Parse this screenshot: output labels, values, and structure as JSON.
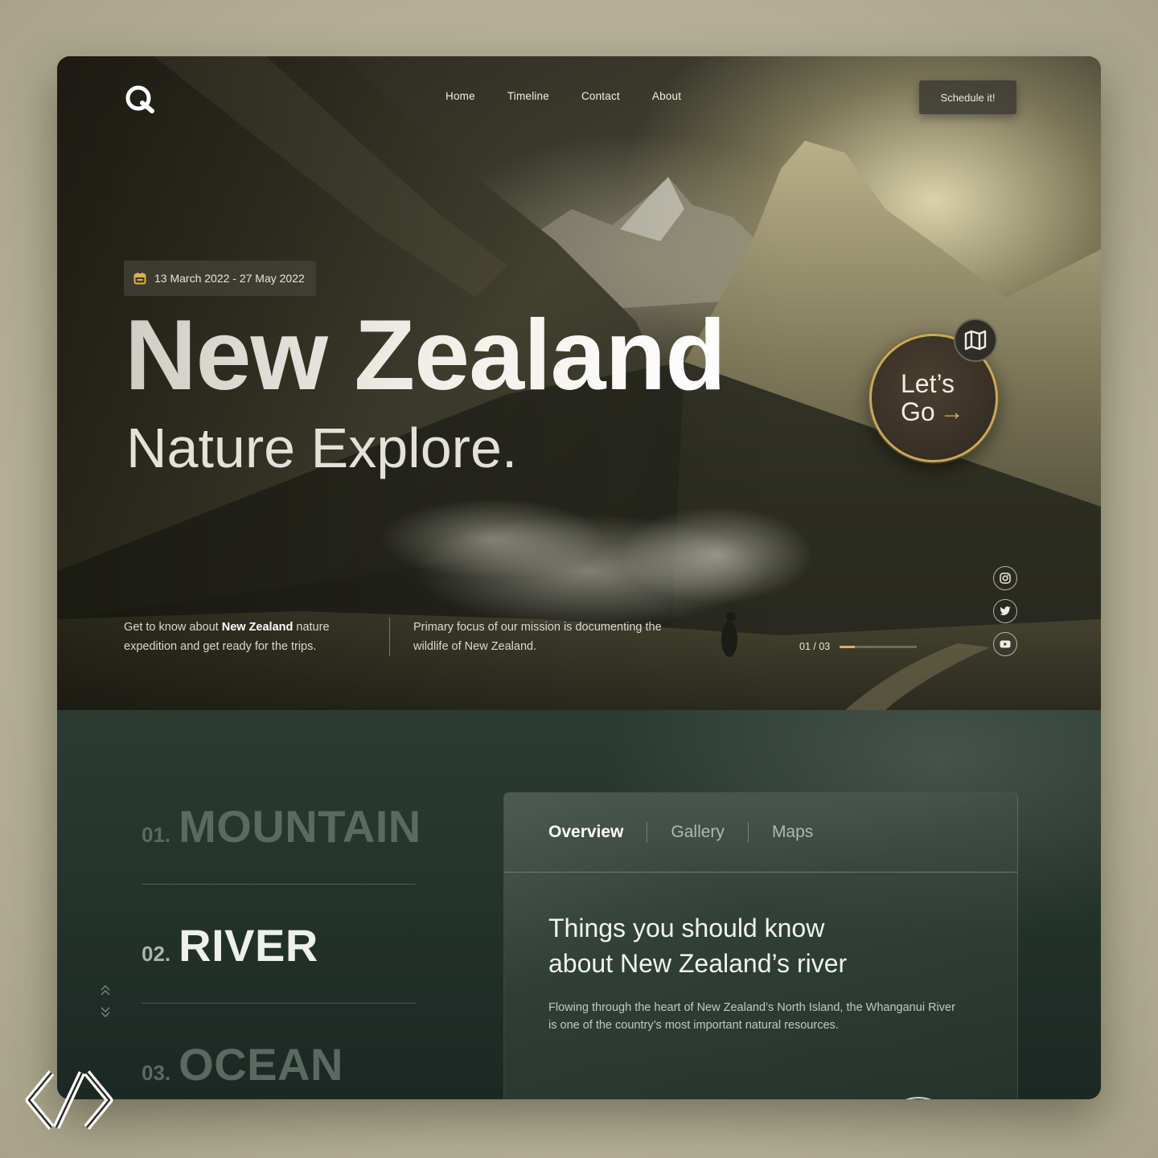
{
  "nav": {
    "items": [
      "Home",
      "Timeline",
      "Contact",
      "About"
    ],
    "cta": "Schedule it!"
  },
  "hero": {
    "date_range": "13 March 2022 - 27 May 2022",
    "title": "New Zealand",
    "subtitle": "Nature Explore.",
    "cta_line1": "Let’s",
    "cta_line2": "Go",
    "cta_arrow": "→",
    "intro_left_pre": "Get to know about ",
    "intro_left_bold": "New Zealand",
    "intro_left_post": " nature expedition and get ready for the trips.",
    "intro_right": "Primary focus of our mission is documenting the wildlife of New Zealand.",
    "pager": "01 / 03",
    "pager_progress": 0.2,
    "social_icons": [
      "instagram-icon",
      "twitter-icon",
      "youtube-icon"
    ]
  },
  "categories": [
    {
      "num": "01.",
      "name": "MOUNTAIN",
      "active": false
    },
    {
      "num": "02.",
      "name": "RIVER",
      "active": true
    },
    {
      "num": "03.",
      "name": "OCEAN",
      "active": false
    }
  ],
  "card": {
    "tabs": [
      "Overview",
      "Gallery",
      "Maps"
    ],
    "active_tab": "Overview",
    "heading_line1": "Things you should know",
    "heading_line2": "about New Zealand’s river",
    "body": "Flowing through the heart of New Zealand’s North Island, the Whanganui River is one of the country’s most important natural resources."
  },
  "colors": {
    "accent_gold": "#d6b25c",
    "lower_bg": "#22302a",
    "page_bg": "#b4af96"
  }
}
